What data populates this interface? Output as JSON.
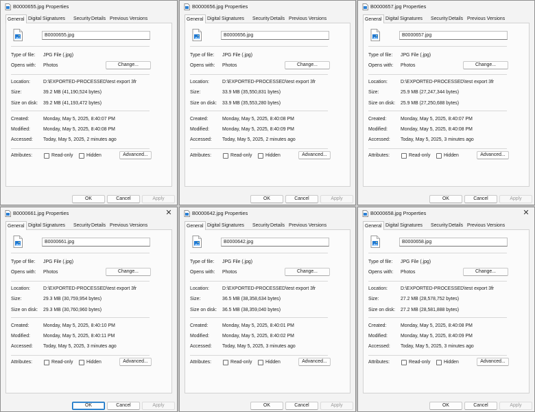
{
  "tabs": [
    "General",
    "Digital Signatures",
    "Security",
    "Details",
    "Previous Versions"
  ],
  "labels": {
    "type_of_file": "Type of file:",
    "opens_with": "Opens with:",
    "location": "Location:",
    "size": "Size:",
    "size_on_disk": "Size on disk:",
    "created": "Created:",
    "modified": "Modified:",
    "accessed": "Accessed:",
    "attributes": "Attributes:"
  },
  "buttons": {
    "change": "Change...",
    "advanced": "Advanced...",
    "ok": "OK",
    "cancel": "Cancel",
    "apply": "Apply"
  },
  "checkboxes": {
    "read_only": "Read-only",
    "hidden": "Hidden"
  },
  "close_glyph": "✕",
  "colors": {
    "accent": "#0067c0",
    "dialog_bg": "#f3f3f3",
    "panel_bg": "#fbfbfb"
  },
  "dialogs": [
    {
      "title": "B0000655.jpg Properties",
      "filename": "B0000655.jpg",
      "type_of_file": "JPG File (.jpg)",
      "opens_with": "Photos",
      "location": "D:\\EXPORTED-PROCESSED\\test export 3fr",
      "size": "39.2 MB (41,190,524 bytes)",
      "size_on_disk": "39.2 MB (41,193,472 bytes)",
      "created": "Monday, May 5, 2025, 8:40:07 PM",
      "modified": "Monday, May 5, 2025, 8:40:08 PM",
      "accessed": "Today, May 5, 2025, 2 minutes ago",
      "has_close": false,
      "ok_focused": false
    },
    {
      "title": "B0000656.jpg Properties",
      "filename": "B0000656.jpg",
      "type_of_file": "JPG File (.jpg)",
      "opens_with": "Photos",
      "location": "D:\\EXPORTED-PROCESSED\\test export 3fr",
      "size": "33.9 MB (35,550,831 bytes)",
      "size_on_disk": "33.9 MB (35,553,280 bytes)",
      "created": "Monday, May 5, 2025, 8:40:08 PM",
      "modified": "Monday, May 5, 2025, 8:40:09 PM",
      "accessed": "Today, May 5, 2025, 2 minutes ago",
      "has_close": false,
      "ok_focused": false
    },
    {
      "title": "B0000657.jpg Properties",
      "filename": "B0000657.jpg",
      "type_of_file": "JPG File (.jpg)",
      "opens_with": "Photos",
      "location": "D:\\EXPORTED-PROCESSED\\test export 3fr",
      "size": "25.9 MB (27,247,344 bytes)",
      "size_on_disk": "25.9 MB (27,250,688 bytes)",
      "created": "Monday, May 5, 2025, 8:40:07 PM",
      "modified": "Monday, May 5, 2025, 8:40:08 PM",
      "accessed": "Today, May 5, 2025, 3 minutes ago",
      "has_close": false,
      "ok_focused": false
    },
    {
      "title": "B0000661.jpg Properties",
      "filename": "B0000661.jpg",
      "type_of_file": "JPG File (.jpg)",
      "opens_with": "Photos",
      "location": "D:\\EXPORTED-PROCESSED\\test export 3fr",
      "size": "29.3 MB (30,759,954 bytes)",
      "size_on_disk": "29.3 MB (30,760,960 bytes)",
      "created": "Monday, May 5, 2025, 8:40:10 PM",
      "modified": "Monday, May 5, 2025, 8:40:11 PM",
      "accessed": "Today, May 5, 2025, 3 minutes ago",
      "has_close": true,
      "ok_focused": true
    },
    {
      "title": "B0000642.jpg Properties",
      "filename": "B0000642.jpg",
      "type_of_file": "JPG File (.jpg)",
      "opens_with": "Photos",
      "location": "D:\\EXPORTED-PROCESSED\\test export 3fr",
      "size": "36.5 MB (38,358,634 bytes)",
      "size_on_disk": "36.5 MB (38,359,040 bytes)",
      "created": "Monday, May 5, 2025, 8:40:01 PM",
      "modified": "Monday, May 5, 2025, 8:40:02 PM",
      "accessed": "Today, May 5, 2025, 3 minutes ago",
      "has_close": false,
      "ok_focused": false
    },
    {
      "title": "B0000658.jpg Properties",
      "filename": "B0000658.jpg",
      "type_of_file": "JPG File (.jpg)",
      "opens_with": "Photos",
      "location": "D:\\EXPORTED-PROCESSED\\test export 3fr",
      "size": "27.2 MB (28,578,752 bytes)",
      "size_on_disk": "27.2 MB (28,581,888 bytes)",
      "created": "Monday, May 5, 2025, 8:40:08 PM",
      "modified": "Monday, May 5, 2025, 8:40:09 PM",
      "accessed": "Today, May 5, 2025, 3 minutes ago",
      "has_close": true,
      "ok_focused": false
    }
  ]
}
